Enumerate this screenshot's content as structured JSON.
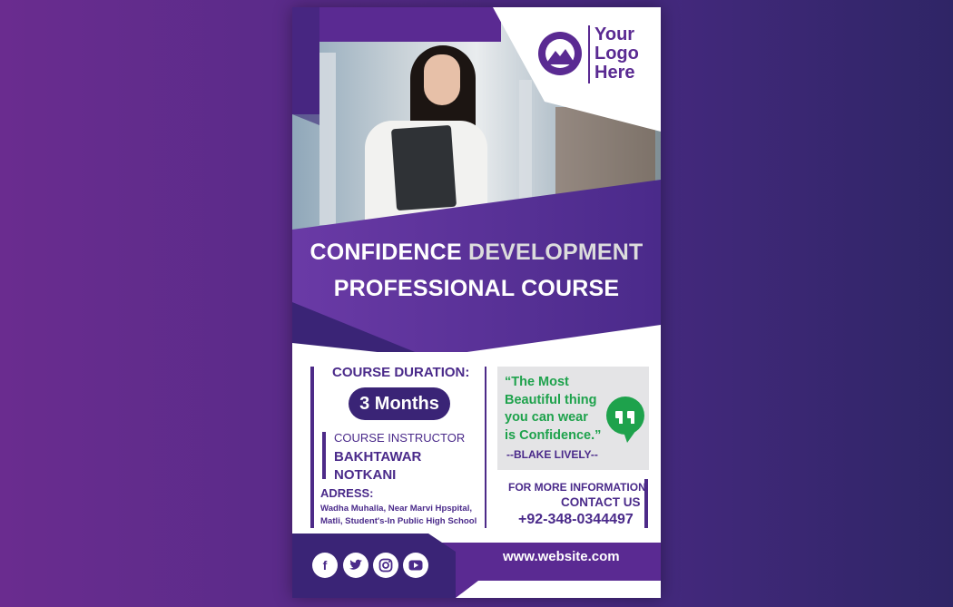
{
  "logo": {
    "line1": "Your",
    "line2": "Logo",
    "line3": "Here"
  },
  "title": {
    "line1_part1": "CONFIDENCE ",
    "line1_part2": "DEVELOPMENT",
    "line2": "PROFESSIONAL COURSE"
  },
  "course": {
    "duration_label": "COURSE DURATION:",
    "duration_value": "3 Months",
    "instructor_label": "COURSE INSTRUCTOR",
    "instructor_name_line1": "BAKHTAWAR",
    "instructor_name_line2": "NOTKANI",
    "address_label": "ADRESS:",
    "address_line1": "Wadha Muhalla, Near Marvi Hpspital,",
    "address_line2": "Matli, Student's-In Public High School"
  },
  "quote": {
    "line1": "“The Most",
    "line2": "Beautiful thing",
    "line3": "you can wear",
    "line4": "is Confidence.”",
    "author": "--BLAKE LIVELY--"
  },
  "contact": {
    "info_label": "FOR MORE INFORMATION",
    "contact_label": "CONTACT US",
    "phone": "+92-348-0344497",
    "website": "www.website.com"
  },
  "colors": {
    "purple_dark": "#3a2476",
    "purple": "#5a2a92",
    "quote_green": "#1ea24c"
  },
  "icons": {
    "social": [
      "facebook-icon",
      "twitter-icon",
      "instagram-icon",
      "youtube-icon"
    ]
  }
}
